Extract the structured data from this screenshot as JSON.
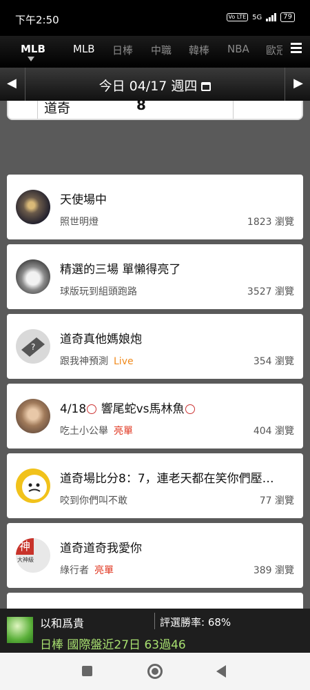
{
  "status": {
    "time": "下午2:50",
    "volte": "Vo LTE",
    "network": "5G",
    "battery": "79"
  },
  "tabs": [
    {
      "label": "MLB"
    },
    {
      "label": "MLB"
    },
    {
      "label": "日棒"
    },
    {
      "label": "中職"
    },
    {
      "label": "韓棒"
    },
    {
      "label": "NBA"
    },
    {
      "label": "歐冠"
    }
  ],
  "datebar": {
    "prev": "◀",
    "date": "今日 04/17 週四",
    "next": "▶"
  },
  "score_peek": {
    "team": "道奇",
    "score": "8"
  },
  "posts": [
    {
      "title": "天使場中",
      "author": "照世明燈",
      "tag": "",
      "views": "1823 瀏覽",
      "avatar": "night-photo"
    },
    {
      "title": "精選的三場 單懶得亮了",
      "author": "球版玩到組頭跑路",
      "tag": "",
      "views": "3527 瀏覽",
      "avatar": "husky-dog"
    },
    {
      "title": "道奇真他媽娘炮",
      "author": "跟我神預測",
      "tag": "Live",
      "views": "354 瀏覽",
      "avatar": "default-user"
    },
    {
      "title_before": "4/18",
      "title_mid": "響尾蛇vs馬林魚",
      "author": "吃土小公舉",
      "tag": "亮單",
      "views": "404 瀏覽",
      "avatar": "girl-photo"
    },
    {
      "title": "道奇場比分8：7，連老天都在笑你們壓…",
      "author": "咬到你們叫不敢",
      "tag": "",
      "views": "77 瀏覽",
      "avatar": "cartoon-face"
    },
    {
      "title": "道奇道奇我愛你",
      "author": "綠行者",
      "tag": "亮單",
      "views": "389 瀏覽",
      "avatar": "god-badge",
      "avatar_text": "神",
      "avatar_sub": "大神級"
    }
  ],
  "bottom": {
    "name": "以和爲貴",
    "win_rate": "評選勝率: 68%",
    "record": "日棒 國際盤近27日 63過46"
  },
  "colors": {
    "live": "#f08a1c",
    "highlight": "#e0341e",
    "record": "#a8e070"
  }
}
